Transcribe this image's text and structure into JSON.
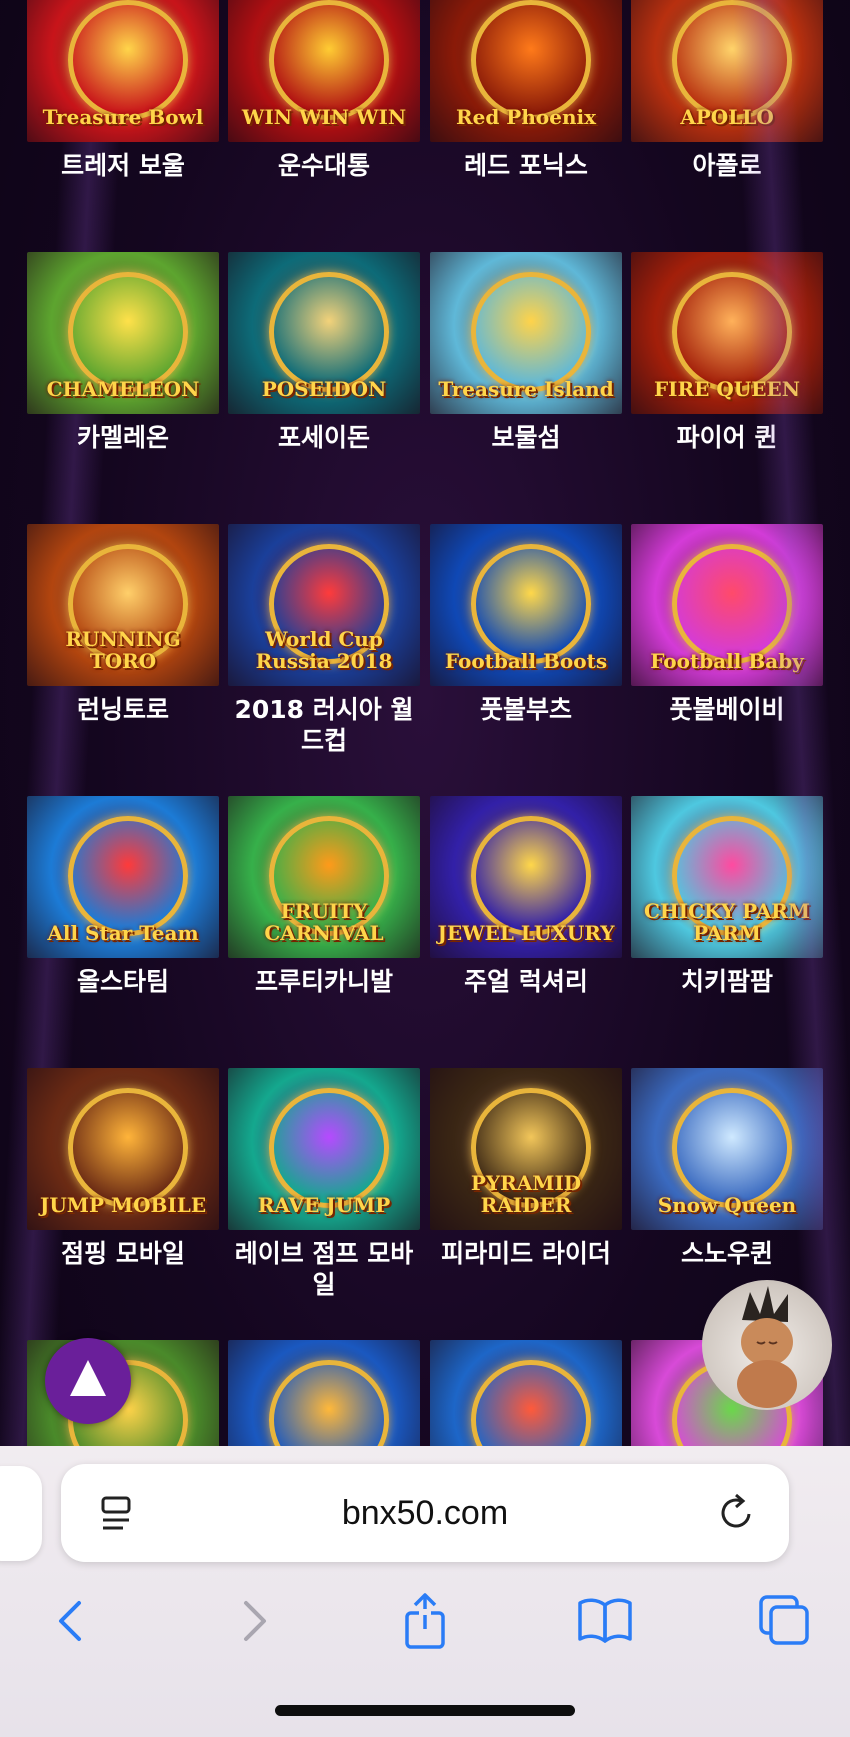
{
  "games": [
    {
      "label": "트레저 보울",
      "art": "Treasure Bowl",
      "bg": "#c8141a",
      "accent": "#ffd54a"
    },
    {
      "label": "운수대통",
      "art": "WIN WIN WIN",
      "bg": "#b00f12",
      "accent": "#ffcc33"
    },
    {
      "label": "레드 포닉스",
      "art": "Red Phoenix",
      "bg": "#8a1a08",
      "accent": "#ff7a1a"
    },
    {
      "label": "아폴로",
      "art": "APOLLO",
      "bg": "#b8300f",
      "accent": "#ffd36a"
    },
    {
      "label": "카멜레온",
      "art": "CHAMELEON",
      "bg": "#5da52f",
      "accent": "#ffe14a"
    },
    {
      "label": "포세이돈",
      "art": "POSEIDON",
      "bg": "#0d6b78",
      "accent": "#f3d27a"
    },
    {
      "label": "보물섬",
      "art": "Treasure Island",
      "bg": "#5fb8d8",
      "accent": "#ffd34a"
    },
    {
      "label": "파이어 퀸",
      "art": "FIRE QUEEN",
      "bg": "#a31f0a",
      "accent": "#ffb15a"
    },
    {
      "label": "런닝토로",
      "art": "RUNNING TORO",
      "bg": "#b2450f",
      "accent": "#ffcf6a"
    },
    {
      "label": "2018 러시아 월드컵",
      "art": "World Cup Russia 2018",
      "bg": "#1a3f9a",
      "accent": "#ff3b3b"
    },
    {
      "label": "풋볼부츠",
      "art": "Football Boots",
      "bg": "#0f48b5",
      "accent": "#ffd84a"
    },
    {
      "label": "풋볼베이비",
      "art": "Football Baby",
      "bg": "#d43bd8",
      "accent": "#ff4a6a"
    },
    {
      "label": "올스타팀",
      "art": "All Star Team",
      "bg": "#1c7bd6",
      "accent": "#ff3a3a"
    },
    {
      "label": "프루티카니발",
      "art": "FRUITY CARNIVAL",
      "bg": "#36b04a",
      "accent": "#ff9a1a"
    },
    {
      "label": "주얼 럭셔리",
      "art": "JEWEL LUXURY",
      "bg": "#3220a8",
      "accent": "#ffd74a"
    },
    {
      "label": "치키팜팜",
      "art": "CHICKY PARM PARM",
      "bg": "#4ec8e0",
      "accent": "#ff4aa0"
    },
    {
      "label": "점핑 모바일",
      "art": "JUMP MOBILE",
      "bg": "#6a2a14",
      "accent": "#ffb43a"
    },
    {
      "label": "레이브 점프 모바일",
      "art": "RAVE JUMP",
      "bg": "#14a88e",
      "accent": "#b64aff"
    },
    {
      "label": "피라미드 라이더",
      "art": "PYRAMID RAIDER",
      "bg": "#3a2614",
      "accent": "#f2c65a"
    },
    {
      "label": "스노우퀸",
      "art": "Snow Queen",
      "bg": "#3a6ac0",
      "accent": "#cfe9ff"
    },
    {
      "label": "",
      "art": "",
      "bg": "#4a8a2a",
      "accent": "#ffd34a"
    },
    {
      "label": "",
      "art": "",
      "bg": "#1a58c0",
      "accent": "#ffb83a"
    },
    {
      "label": "",
      "art": "",
      "bg": "#1d66c8",
      "accent": "#ff5a3a"
    },
    {
      "label": "",
      "art": "",
      "bg": "#d84ad8",
      "accent": "#6ad84a"
    }
  ],
  "browser": {
    "url": "bnx50.com",
    "accent_color": "#2a7cf6"
  }
}
